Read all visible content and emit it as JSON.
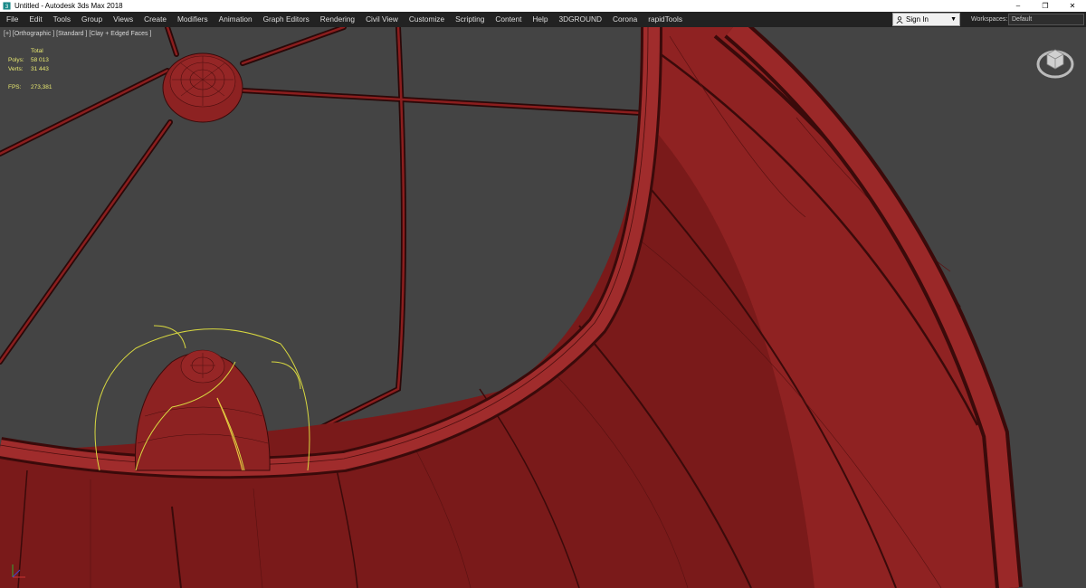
{
  "window": {
    "title": "Untitled - Autodesk 3ds Max 2018",
    "app_icon": "3ds-max-logo-icon",
    "buttons": {
      "minimize": "–",
      "maximize": "❐",
      "close": "✕"
    }
  },
  "menu": [
    "File",
    "Edit",
    "Tools",
    "Group",
    "Views",
    "Create",
    "Modifiers",
    "Animation",
    "Graph Editors",
    "Rendering",
    "Civil View",
    "Customize",
    "Scripting",
    "Content",
    "Help",
    "3DGROUND",
    "Corona",
    "rapidTools"
  ],
  "signin": {
    "label": "Sign In",
    "icon": "user-icon"
  },
  "workspaces": {
    "label": "Workspaces:",
    "value": "Default"
  },
  "viewport": {
    "label": "[+] [Orthographic ] [Standard ] [Clay + Edged Faces ]",
    "stats": {
      "header": "Total",
      "polys_label": "Polys:",
      "polys": "58 013",
      "verts_label": "Verts:",
      "verts": "31 443",
      "fps_label": "FPS:",
      "fps": "273,381"
    },
    "viewcube_icon": "viewcube-icon",
    "axis_icon": "axis-tripod-icon"
  },
  "colors": {
    "viewport_bg": "#444444",
    "model": "#8c1f1f",
    "selection": "#e0e040",
    "menubar": "#222222"
  }
}
